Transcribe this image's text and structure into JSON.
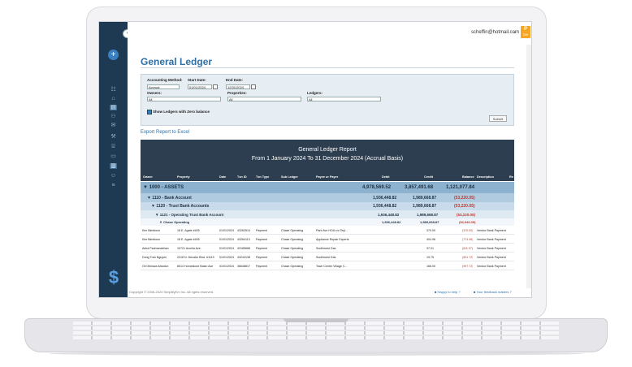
{
  "user": {
    "email": "scheffin@hotmail.com",
    "badge_top": "P",
    "badge_bottom": "339"
  },
  "page": {
    "title": "General Ledger",
    "export_label": "Export Report to Excel"
  },
  "filters": {
    "accounting_method_label": "Accounting Method:",
    "accounting_method_value": "Accrual",
    "start_date_label": "Start Date:",
    "start_date_value": "01/01/2024",
    "end_date_label": "End Date:",
    "end_date_value": "12/31/2024",
    "owners_label": "Owners:",
    "owners_value": "All",
    "properties_label": "Properties:",
    "properties_value": "All",
    "ledgers_label": "Ledgers:",
    "ledgers_value": "All",
    "zero_balance_label": "Show Ledgers with Zero balance",
    "submit_label": "Submit"
  },
  "report": {
    "title": "General Ledger Report",
    "subtitle": "From 1 January 2024 To 31 December 2024 (Accrual Basis)",
    "columns": [
      "Owner",
      "Property",
      "Date",
      "Txn ID",
      "Txn Type",
      "Sub Ledger",
      "Payee or Payer",
      "Debit",
      "Credit",
      "Balance",
      "Description",
      "Re"
    ],
    "groups": [
      {
        "label": "▼ 1000 - ASSETS",
        "debit": "4,978,569.52",
        "credit": "3,857,491.68",
        "balance": "1,121,077.84"
      },
      {
        "label": "▼ 1110 - Bank Account",
        "debit": "1,936,448.82",
        "credit": "1,989,668.87",
        "balance": "(53,220.05)"
      },
      {
        "label": "▼ 1120 - Trust Bank Accounts",
        "debit": "1,936,448.82",
        "credit": "1,989,668.87",
        "balance": "(53,220.05)"
      },
      {
        "label": "▼ 1121 - Operating Trust Bank Account",
        "debit": "1,936,448.82",
        "credit": "1,989,668.87",
        "balance": "(53,220.05)"
      },
      {
        "label": "▼ Chase Operating",
        "debit": "1,936,448.82",
        "credit": "1,989,668.87",
        "balance": "(54,946.05)"
      }
    ],
    "rows": [
      {
        "owner": "Kim Bimbloon",
        "property": "18 E. Agate #405",
        "date": "01/01/2024",
        "txn": "43263514",
        "type": "Payment",
        "sub": "Chase Operating",
        "payee": "Park Ave HOA c/o Teyl...",
        "debit": "",
        "credit": "370.00",
        "balance": "(370.00)",
        "desc": "Vendor Bank Payment"
      },
      {
        "owner": "Kim Bimbloon",
        "property": "18 E. Agate #405",
        "date": "01/01/2024",
        "txn": "43264113",
        "type": "Payment",
        "sub": "Chase Operating",
        "payee": "Appliance Repair Experts",
        "debit": "",
        "credit": "404.96",
        "balance": "(774.96)",
        "desc": "Vendor Bank Payment"
      },
      {
        "owner": "Asha Padmanabhan",
        "property": "10721 Arcelia Ave.",
        "date": "01/01/2024",
        "txn": "43185666",
        "type": "Payment",
        "sub": "Chase Operating",
        "payee": "Southwest Gas",
        "debit": "",
        "credit": "37.01",
        "balance": "(811.97)",
        "desc": "Vendor Bank Payment"
      },
      {
        "owner": "Dung Tran Nguyen",
        "property": "2218 N. Decatur Blvd. #1119",
        "date": "01/01/2024",
        "txn": "43244138",
        "type": "Payment",
        "sub": "Chase Operating",
        "payee": "Southwest Gas",
        "debit": "",
        "credit": "19.75",
        "balance": "(831.72)",
        "desc": "Vendor Bank Payment"
      },
      {
        "owner": "Oli Obilowa Abiodun",
        "property": "8014 Homestone Basin Ave",
        "date": "01/01/2024",
        "txn": "36648817",
        "type": "Payment",
        "sub": "Chase Operating",
        "payee": "Town Center Village C...",
        "debit": "",
        "credit": "166.00",
        "balance": "(997.72)",
        "desc": "Vendor Bank Payment"
      }
    ]
  },
  "footer": {
    "copyright": "Copyright © 2006-2024 SimplifyEm Inc. All rights reserved.",
    "help": "■ Happy to help ?",
    "feedback": "■ Your feedback matters ?"
  }
}
